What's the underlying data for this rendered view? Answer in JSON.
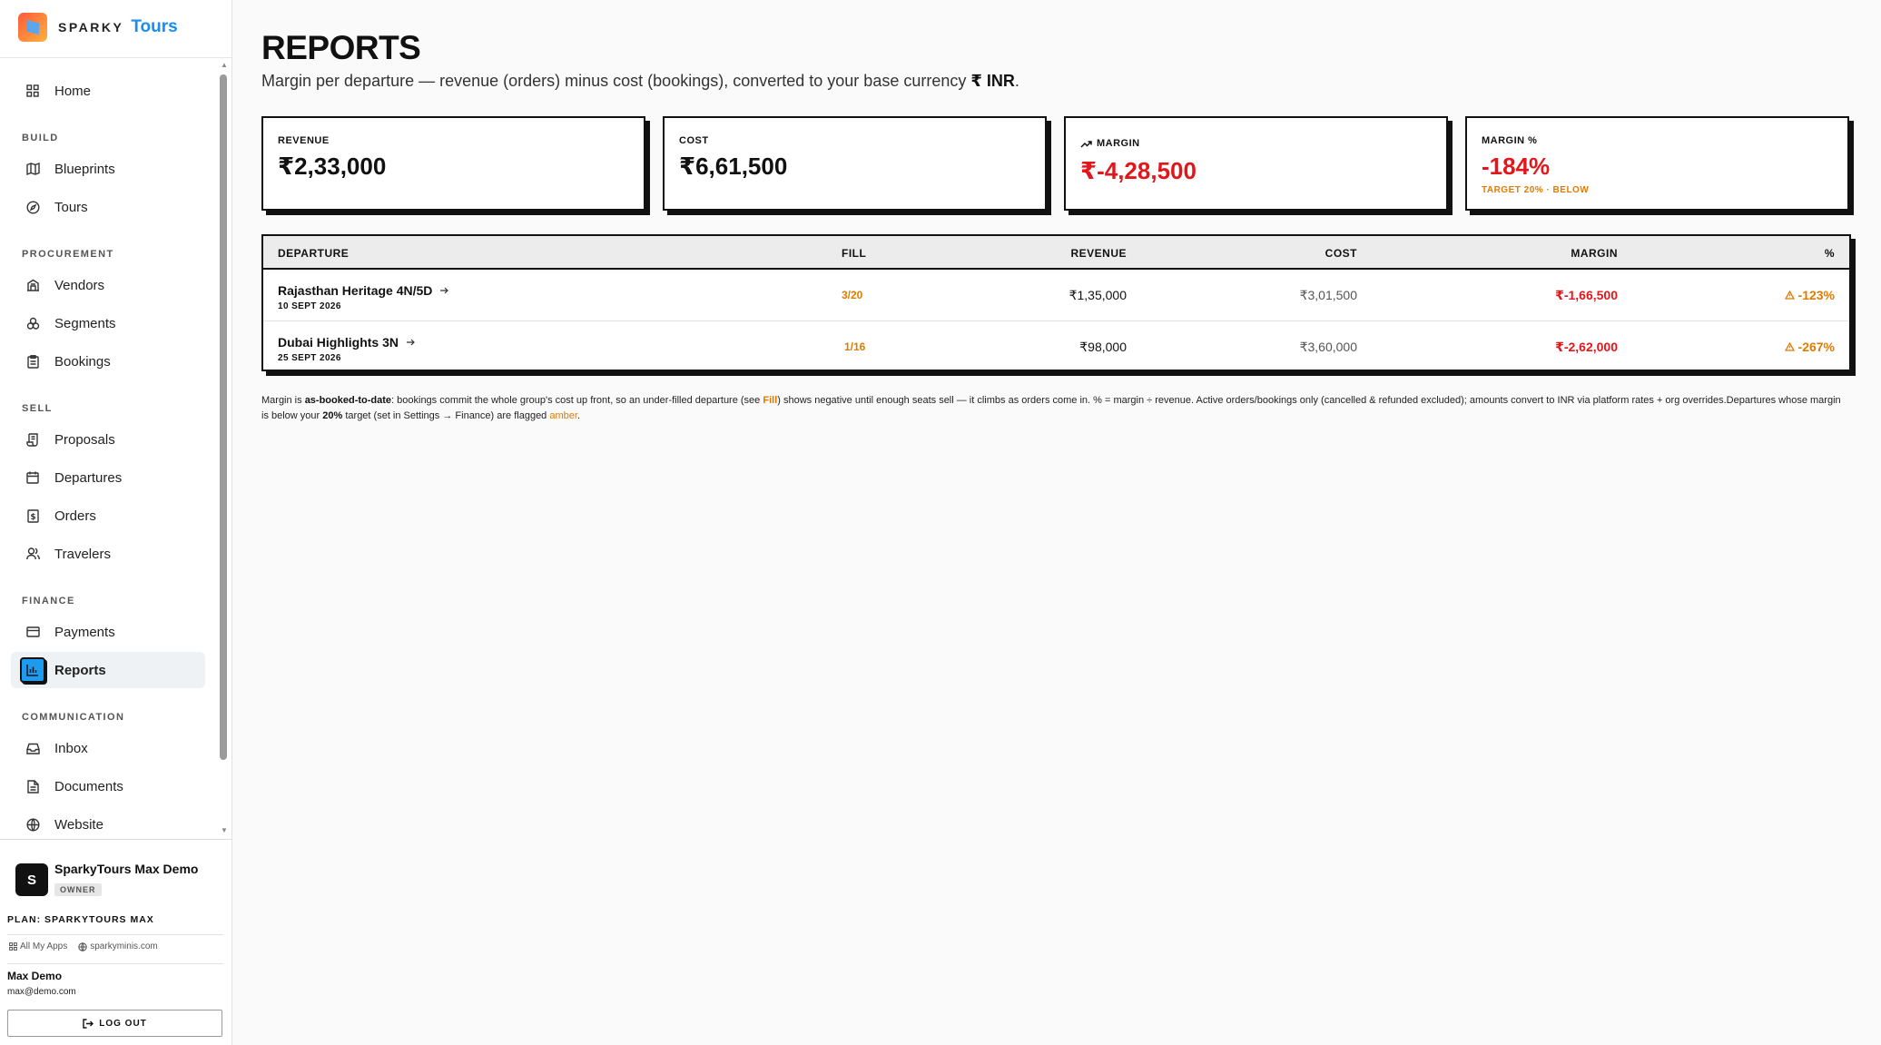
{
  "brand": {
    "word1": "SPARKY",
    "word2": "Tours"
  },
  "sidebar": {
    "home": "Home",
    "sections": {
      "build": "BUILD",
      "procurement": "PROCUREMENT",
      "sell": "SELL",
      "finance": "FINANCE",
      "communication": "COMMUNICATION"
    },
    "items": {
      "blueprints": "Blueprints",
      "tours": "Tours",
      "vendors": "Vendors",
      "segments": "Segments",
      "bookings": "Bookings",
      "proposals": "Proposals",
      "departures": "Departures",
      "orders": "Orders",
      "travelers": "Travelers",
      "payments": "Payments",
      "reports": "Reports",
      "inbox": "Inbox",
      "documents": "Documents",
      "website": "Website"
    },
    "active": "reports"
  },
  "workspace": {
    "avatar": "S",
    "name": "SparkyTours Max Demo",
    "role": "OWNER",
    "plan": "PLAN: SPARKYTOURS MAX",
    "all_apps": "All My Apps",
    "site": "sparkyminis.com"
  },
  "user": {
    "name": "Max Demo",
    "email": "max@demo.com",
    "logout": "LOG OUT"
  },
  "page": {
    "title": "REPORTS",
    "subtitle": "Margin per departure — revenue (orders) minus cost (bookings), converted to your base currency",
    "currency": "₹ INR",
    "subtitle_end": "."
  },
  "stats": {
    "revenue": {
      "label": "REVENUE",
      "value": "₹2,33,000"
    },
    "cost": {
      "label": "COST",
      "value": "₹6,61,500"
    },
    "margin": {
      "label": "MARGIN",
      "value": "₹-4,28,500"
    },
    "margin_pct": {
      "label": "MARGIN %",
      "value": "-184%",
      "sub": "TARGET 20% · BELOW"
    }
  },
  "table": {
    "headers": {
      "departure": "DEPARTURE",
      "fill": "FILL",
      "revenue": "REVENUE",
      "cost": "COST",
      "margin": "MARGIN",
      "pct": "%"
    },
    "rows": [
      {
        "name": "Rajasthan Heritage 4N/5D",
        "date": "10 SEPT 2026",
        "fill": "3/20",
        "revenue": "₹1,35,000",
        "cost": "₹3,01,500",
        "margin": "₹-1,66,500",
        "pct": "-123%"
      },
      {
        "name": "Dubai Highlights 3N",
        "date": "25 SEPT 2026",
        "fill": "1/16",
        "revenue": "₹98,000",
        "cost": "₹3,60,000",
        "margin": "₹-2,62,000",
        "pct": "-267%"
      }
    ]
  },
  "footnote": {
    "p1": "Margin is ",
    "b1": "as-booked-to-date",
    "p2": ": bookings commit the whole group's cost up front, so an under-filled departure (see ",
    "fill": "Fill",
    "p3": ") shows negative until enough seats sell — it climbs as orders come in. % = margin ÷ revenue. Active orders/bookings only (cancelled & refunded excluded); amounts convert to INR via platform rates + org overrides.Departures whose margin is below your ",
    "b2": "20%",
    "p4": " target (set in Settings → Finance) are flagged ",
    "amber": "amber",
    "p5": "."
  },
  "colors": {
    "accent": "#1d9bf0",
    "negative": "#e3161b",
    "warning": "#e07b00"
  }
}
